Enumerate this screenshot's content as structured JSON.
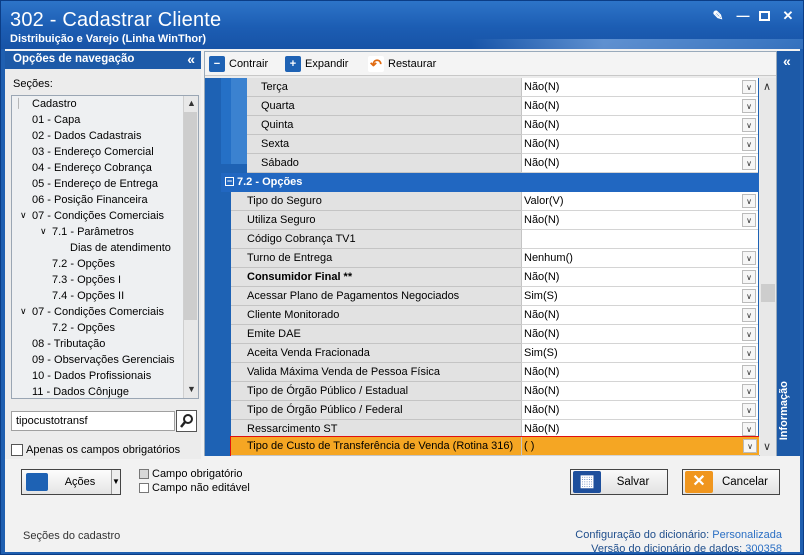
{
  "window": {
    "title": "302 - Cadastrar Cliente",
    "subtitle": "Distribuição e Varejo (Linha WinThor)"
  },
  "nav": {
    "header": "Opções de navegação",
    "sections_label": "Seções:",
    "tree": [
      {
        "label": "Cadastro"
      },
      {
        "label": "01 - Capa"
      },
      {
        "label": "02 - Dados Cadastrais"
      },
      {
        "label": "03 - Endereço Comercial"
      },
      {
        "label": "04 - Endereço Cobrança"
      },
      {
        "label": "05 - Endereço de Entrega"
      },
      {
        "label": "06 - Posição Financeira"
      },
      {
        "label": "07 - Condições Comerciais"
      },
      {
        "label": "7.1 - Parâmetros"
      },
      {
        "label": "Dias de atendimento"
      },
      {
        "label": "7.2 - Opções"
      },
      {
        "label": "7.3 - Opções I"
      },
      {
        "label": "7.4 - Opções II"
      },
      {
        "label": "07 - Condições Comerciais"
      },
      {
        "label": "7.2 - Opções"
      },
      {
        "label": "08 - Tributação"
      },
      {
        "label": "09 - Observações Gerenciais"
      },
      {
        "label": "10 - Dados Profissionais"
      },
      {
        "label": "11 - Dados Cônjuge"
      }
    ],
    "search_value": "tipocustotransf",
    "required_only_label": "Apenas os campos obrigatórios"
  },
  "toolbar": {
    "collapse": "Contrair",
    "expand": "Expandir",
    "restore": "Restaurar"
  },
  "grid": {
    "rows_top": [
      {
        "label": "Terça",
        "value": "Não(N)"
      },
      {
        "label": "Quarta",
        "value": "Não(N)"
      },
      {
        "label": "Quinta",
        "value": "Não(N)"
      },
      {
        "label": "Sexta",
        "value": "Não(N)"
      },
      {
        "label": "Sábado",
        "value": "Não(N)"
      }
    ],
    "section_title": "7.2 - Opções",
    "rows": [
      {
        "label": "Tipo do Seguro",
        "value": "Valor(V)"
      },
      {
        "label": "Utiliza Seguro",
        "value": "Não(N)"
      },
      {
        "label": "Código Cobrança TV1",
        "value": ""
      },
      {
        "label": "Turno de Entrega",
        "value": "Nenhum()"
      },
      {
        "label": "Consumidor Final **",
        "value": "Não(N)"
      },
      {
        "label": "Acessar Plano de Pagamentos Negociados",
        "value": "Sim(S)"
      },
      {
        "label": "Cliente Monitorado",
        "value": "Não(N)"
      },
      {
        "label": "Emite DAE",
        "value": "Não(N)"
      },
      {
        "label": "Aceita Venda Fracionada",
        "value": "Sim(S)"
      },
      {
        "label": "Valida Máxima Venda de Pessoa Física",
        "value": "Não(N)"
      },
      {
        "label": "Tipo de Órgão Público / Estadual",
        "value": "Não(N)"
      },
      {
        "label": "Tipo de Órgão Público / Federal",
        "value": "Não(N)"
      },
      {
        "label": "Ressarcimento ST",
        "value": "Não(N)"
      },
      {
        "label": "Tipo de Custo de Transferência de Venda (Rotina 316)",
        "value": "( )"
      }
    ]
  },
  "info_tab": "Informação",
  "bottom": {
    "actions": "Ações",
    "legend_required": "Campo obrigatório",
    "legend_readonly": "Campo não editável",
    "save": "Salvar",
    "cancel": "Cancelar",
    "status_left": "Seções do cadastro",
    "dict_config_label": "Configuração do dicionário:",
    "dict_config_value": "Personalizada",
    "dict_version_label": "Versão do dicionário de dados:",
    "dict_version_value": "300358"
  },
  "colors": {
    "title_blue": "#1c5db3",
    "section_blue": "#2167c1",
    "highlight_orange": "#f5a623",
    "highlight_border": "#e01010"
  }
}
